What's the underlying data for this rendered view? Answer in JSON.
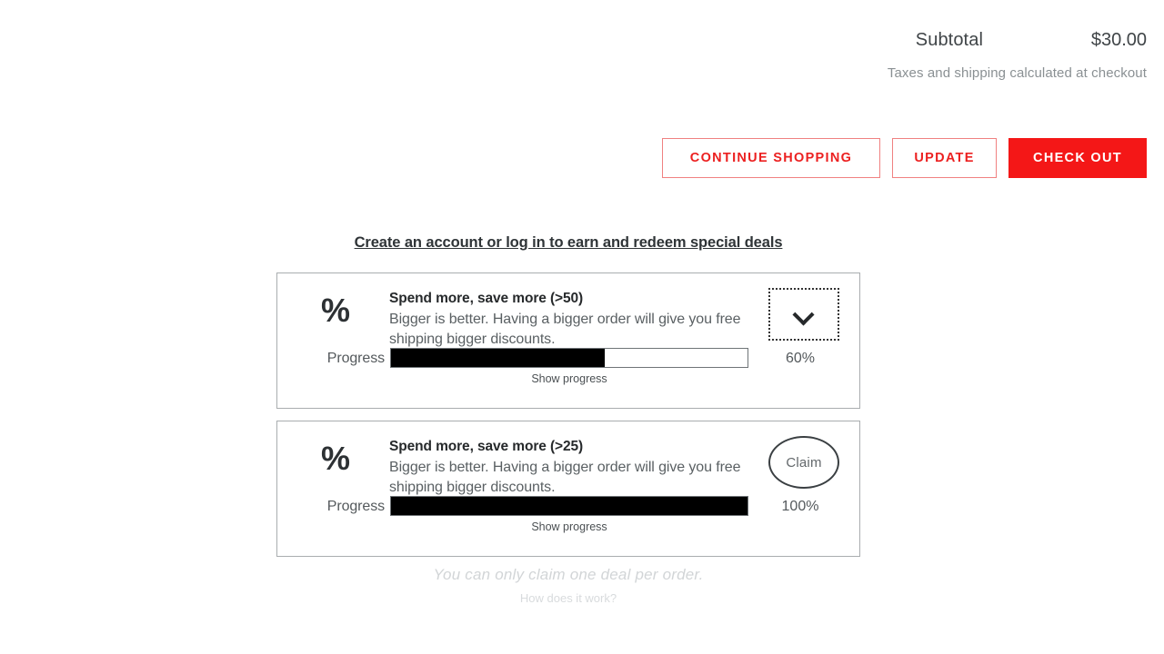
{
  "summary": {
    "subtotal_label": "Subtotal",
    "subtotal_value": "$30.00",
    "taxes_note": "Taxes and shipping calculated at checkout"
  },
  "actions": {
    "continue_label": "CONTINUE SHOPPING",
    "update_label": "UPDATE",
    "checkout_label": "CHECK OUT",
    "accent_outline": "#ec2020",
    "accent_solid": "#f41717"
  },
  "deals": {
    "account_link": "Create an account or log in to earn and redeem special deals",
    "cards": [
      {
        "icon": "%",
        "title": "Spend more, save more (>50)",
        "description": "Bigger is better. Having a bigger order will give you free shipping bigger discounts.",
        "progress_label": "Progress",
        "progress_percent": "60%",
        "progress_value": 60,
        "show_progress_label": "Show progress",
        "action_type": "chevron-down",
        "action_label": ""
      },
      {
        "icon": "%",
        "title": "Spend more, save more (>25)",
        "description": "Bigger is better. Having a bigger order will give you free shipping bigger discounts.",
        "progress_label": "Progress",
        "progress_percent": "100%",
        "progress_value": 100,
        "show_progress_label": "Show progress",
        "action_type": "claim-button",
        "action_label": "Claim"
      }
    ],
    "footer_note": "You can only claim one deal per order.",
    "footer_link": "How does it work?"
  }
}
